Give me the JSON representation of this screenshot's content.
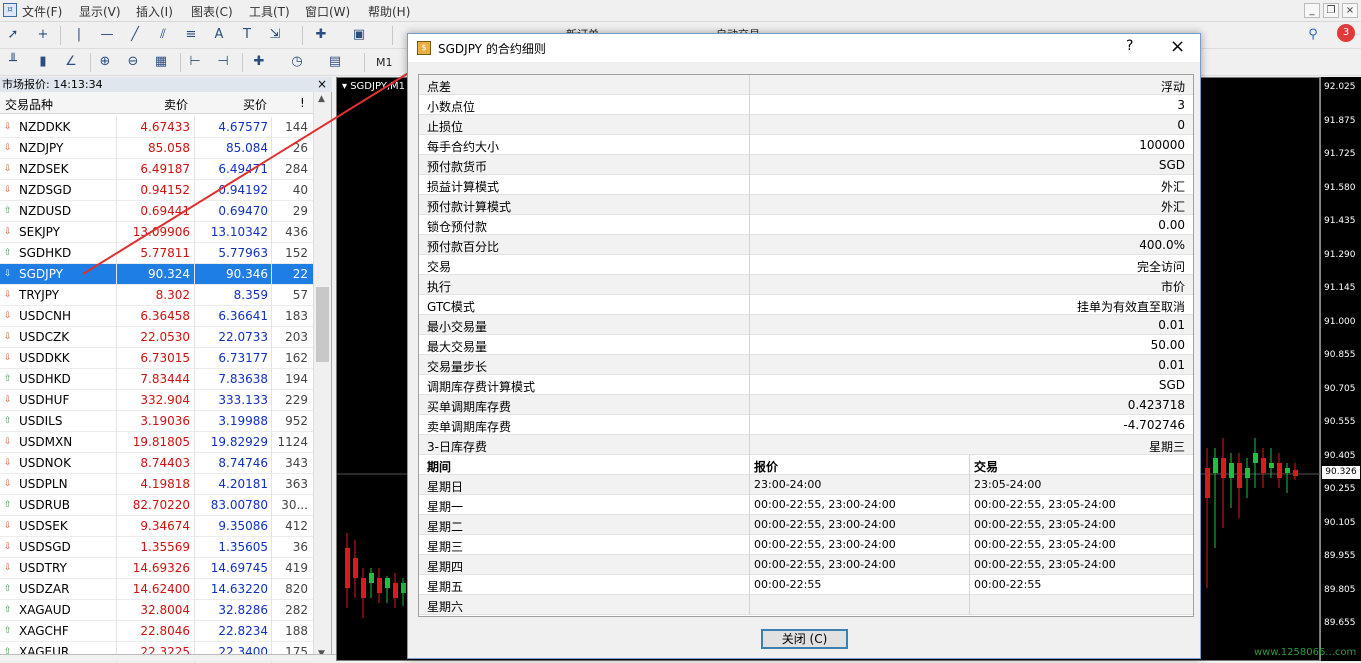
{
  "menubar": {
    "items": [
      "文件(F)",
      "显示(V)",
      "插入(I)",
      "图表(C)",
      "工具(T)",
      "窗口(W)",
      "帮助(H)"
    ]
  },
  "toolbar": {
    "timeframe": "M1",
    "new_order": "新订单",
    "auto_trading": "自动交易"
  },
  "market_watch": {
    "title": "市场报价: 14:13:34",
    "columns": [
      "交易品种",
      "卖价",
      "买价",
      "!"
    ],
    "rows": [
      {
        "symbol": "NZDDKK",
        "bid": "4.67433",
        "ask": "4.67577",
        "spread": "144",
        "dir": "down"
      },
      {
        "symbol": "NZDJPY",
        "bid": "85.058",
        "ask": "85.084",
        "spread": "26",
        "dir": "down"
      },
      {
        "symbol": "NZDSEK",
        "bid": "6.49187",
        "ask": "6.49471",
        "spread": "284",
        "dir": "down"
      },
      {
        "symbol": "NZDSGD",
        "bid": "0.94152",
        "ask": "0.94192",
        "spread": "40",
        "dir": "down"
      },
      {
        "symbol": "NZDUSD",
        "bid": "0.69441",
        "ask": "0.69470",
        "spread": "29",
        "dir": "up"
      },
      {
        "symbol": "SEKJPY",
        "bid": "13.09906",
        "ask": "13.10342",
        "spread": "436",
        "dir": "down"
      },
      {
        "symbol": "SGDHKD",
        "bid": "5.77811",
        "ask": "5.77963",
        "spread": "152",
        "dir": "up"
      },
      {
        "symbol": "SGDJPY",
        "bid": "90.324",
        "ask": "90.346",
        "spread": "22",
        "dir": "down",
        "selected": true
      },
      {
        "symbol": "TRYJPY",
        "bid": "8.302",
        "ask": "8.359",
        "spread": "57",
        "dir": "down"
      },
      {
        "symbol": "USDCNH",
        "bid": "6.36458",
        "ask": "6.36641",
        "spread": "183",
        "dir": "down"
      },
      {
        "symbol": "USDCZK",
        "bid": "22.0530",
        "ask": "22.0733",
        "spread": "203",
        "dir": "down"
      },
      {
        "symbol": "USDDKK",
        "bid": "6.73015",
        "ask": "6.73177",
        "spread": "162",
        "dir": "down"
      },
      {
        "symbol": "USDHKD",
        "bid": "7.83444",
        "ask": "7.83638",
        "spread": "194",
        "dir": "up"
      },
      {
        "symbol": "USDHUF",
        "bid": "332.904",
        "ask": "333.133",
        "spread": "229",
        "dir": "down"
      },
      {
        "symbol": "USDILS",
        "bid": "3.19036",
        "ask": "3.19988",
        "spread": "952",
        "dir": "up"
      },
      {
        "symbol": "USDMXN",
        "bid": "19.81805",
        "ask": "19.82929",
        "spread": "1124",
        "dir": "down"
      },
      {
        "symbol": "USDNOK",
        "bid": "8.74403",
        "ask": "8.74746",
        "spread": "343",
        "dir": "down"
      },
      {
        "symbol": "USDPLN",
        "bid": "4.19818",
        "ask": "4.20181",
        "spread": "363",
        "dir": "down"
      },
      {
        "symbol": "USDRUB",
        "bid": "82.70220",
        "ask": "83.00780",
        "spread": "30...",
        "dir": "up"
      },
      {
        "symbol": "USDSEK",
        "bid": "9.34674",
        "ask": "9.35086",
        "spread": "412",
        "dir": "down"
      },
      {
        "symbol": "USDSGD",
        "bid": "1.35569",
        "ask": "1.35605",
        "spread": "36",
        "dir": "down"
      },
      {
        "symbol": "USDTRY",
        "bid": "14.69326",
        "ask": "14.69745",
        "spread": "419",
        "dir": "down"
      },
      {
        "symbol": "USDZAR",
        "bid": "14.62400",
        "ask": "14.63220",
        "spread": "820",
        "dir": "up"
      },
      {
        "symbol": "XAGAUD",
        "bid": "32.8004",
        "ask": "32.8286",
        "spread": "282",
        "dir": "up"
      },
      {
        "symbol": "XAGCHF",
        "bid": "22.8046",
        "ask": "22.8234",
        "spread": "188",
        "dir": "up"
      },
      {
        "symbol": "XAGEUR",
        "bid": "22.3225",
        "ask": "22.3400",
        "spread": "175",
        "dir": "up"
      }
    ]
  },
  "chart": {
    "title": "SGDJPY,M1",
    "price_ticks": [
      "92.025",
      "91.875",
      "91.725",
      "91.580",
      "91.435",
      "91.290",
      "91.145",
      "91.000",
      "90.855",
      "90.705",
      "90.555",
      "90.405",
      "90.255",
      "90.105",
      "89.955",
      "89.805",
      "89.655"
    ],
    "current_price": "90.326",
    "watermark": "www.1258066...com"
  },
  "dialog": {
    "title": "SGDJPY 的合约细则",
    "help": "?",
    "close_label": "关闭 (C)",
    "properties": [
      {
        "key": "点差",
        "value": "浮动"
      },
      {
        "key": "小数点位",
        "value": "3"
      },
      {
        "key": "止损位",
        "value": "0"
      },
      {
        "key": "每手合约大小",
        "value": "100000"
      },
      {
        "key": "预付款货币",
        "value": "SGD"
      },
      {
        "key": "损益计算模式",
        "value": "外汇"
      },
      {
        "key": "预付款计算模式",
        "value": "外汇"
      },
      {
        "key": "锁仓预付款",
        "value": "0.00"
      },
      {
        "key": "预付款百分比",
        "value": "400.0%"
      },
      {
        "key": "交易",
        "value": "完全访问"
      },
      {
        "key": "执行",
        "value": "市价"
      },
      {
        "key": "GTC模式",
        "value": "挂单为有效直至取消"
      },
      {
        "key": "最小交易量",
        "value": "0.01"
      },
      {
        "key": "最大交易量",
        "value": "50.00"
      },
      {
        "key": "交易量步长",
        "value": "0.01"
      },
      {
        "key": "调期库存费计算模式",
        "value": "SGD"
      },
      {
        "key": "买单调期库存费",
        "value": "0.423718"
      },
      {
        "key": "卖单调期库存费",
        "value": "-4.702746"
      },
      {
        "key": "3-日库存费",
        "value": "星期三"
      }
    ],
    "sessions_header": [
      "期间",
      "报价",
      "交易"
    ],
    "sessions": [
      {
        "day": "星期日",
        "quotes": "23:00-24:00",
        "trade": "23:05-24:00"
      },
      {
        "day": "星期一",
        "quotes": "00:00-22:55, 23:00-24:00",
        "trade": "00:00-22:55, 23:05-24:00"
      },
      {
        "day": "星期二",
        "quotes": "00:00-22:55, 23:00-24:00",
        "trade": "00:00-22:55, 23:05-24:00"
      },
      {
        "day": "星期三",
        "quotes": "00:00-22:55, 23:00-24:00",
        "trade": "00:00-22:55, 23:05-24:00"
      },
      {
        "day": "星期四",
        "quotes": "00:00-22:55, 23:00-24:00",
        "trade": "00:00-22:55, 23:05-24:00"
      },
      {
        "day": "星期五",
        "quotes": "00:00-22:55",
        "trade": "00:00-22:55"
      },
      {
        "day": "星期六",
        "quotes": "",
        "trade": ""
      }
    ]
  },
  "notifications": {
    "count": "3"
  },
  "colors": {
    "up": "#2e9a3e",
    "down": "#d9531e",
    "selected": "#1e7ee4",
    "bid_text": "#d01010",
    "ask_text": "#1030c0"
  }
}
